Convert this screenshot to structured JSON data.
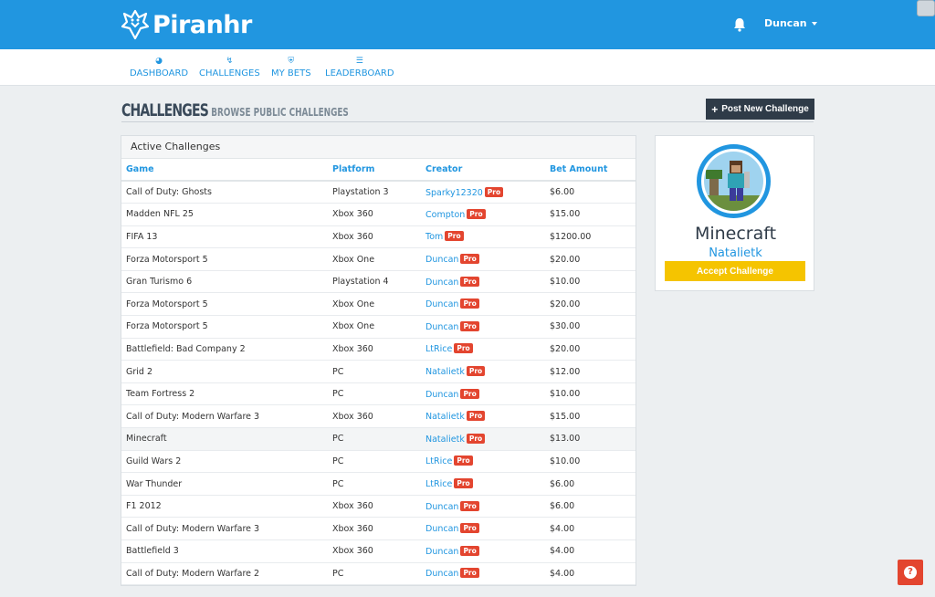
{
  "brand": {
    "name": "Piranhr",
    "logo_icon": "piranha-logo-icon"
  },
  "header": {
    "user_name": "Duncan",
    "bell_icon": "bell-icon"
  },
  "nav": [
    {
      "label": "DASHBOARD",
      "icon": "dashboard-icon"
    },
    {
      "label": "CHALLENGES",
      "icon": "bolt-icon"
    },
    {
      "label": "MY BETS",
      "icon": "shield-icon"
    },
    {
      "label": "LEADERBOARD",
      "icon": "list-icon"
    }
  ],
  "page": {
    "title": "CHALLENGES",
    "subtitle": "BROWSE PUBLIC CHALLENGES",
    "post_button": "Post New Challenge"
  },
  "panel": {
    "heading": "Active Challenges",
    "columns": [
      "Game",
      "Platform",
      "Creator",
      "Bet Amount"
    ],
    "badge": "Pro",
    "rows": [
      {
        "game": "Call of Duty: Ghosts",
        "platform": "Playstation 3",
        "creator": "Sparky12320",
        "bet": "$6.00"
      },
      {
        "game": "Madden NFL 25",
        "platform": "Xbox 360",
        "creator": "Compton",
        "bet": "$15.00"
      },
      {
        "game": "FIFA 13",
        "platform": "Xbox 360",
        "creator": "Tom",
        "bet": "$1200.00"
      },
      {
        "game": "Forza Motorsport 5",
        "platform": "Xbox One",
        "creator": "Duncan",
        "bet": "$20.00"
      },
      {
        "game": "Gran Turismo 6",
        "platform": "Playstation 4",
        "creator": "Duncan",
        "bet": "$10.00"
      },
      {
        "game": "Forza Motorsport 5",
        "platform": "Xbox One",
        "creator": "Duncan",
        "bet": "$20.00"
      },
      {
        "game": "Forza Motorsport 5",
        "platform": "Xbox One",
        "creator": "Duncan",
        "bet": "$30.00"
      },
      {
        "game": "Battlefield: Bad Company 2",
        "platform": "Xbox 360",
        "creator": "LtRice",
        "bet": "$20.00"
      },
      {
        "game": "Grid 2",
        "platform": "PC",
        "creator": "Natalietk",
        "bet": "$12.00"
      },
      {
        "game": "Team Fortress 2",
        "platform": "PC",
        "creator": "Duncan",
        "bet": "$10.00"
      },
      {
        "game": "Call of Duty: Modern Warfare 3",
        "platform": "Xbox 360",
        "creator": "Natalietk",
        "bet": "$15.00"
      },
      {
        "game": "Minecraft",
        "platform": "PC",
        "creator": "Natalietk",
        "bet": "$13.00"
      },
      {
        "game": "Guild Wars 2",
        "platform": "PC",
        "creator": "LtRice",
        "bet": "$10.00"
      },
      {
        "game": "War Thunder",
        "platform": "PC",
        "creator": "LtRice",
        "bet": "$6.00"
      },
      {
        "game": "F1 2012",
        "platform": "Xbox 360",
        "creator": "Duncan",
        "bet": "$6.00"
      },
      {
        "game": "Call of Duty: Modern Warfare 3",
        "platform": "Xbox 360",
        "creator": "Duncan",
        "bet": "$4.00"
      },
      {
        "game": "Battlefield 3",
        "platform": "Xbox 360",
        "creator": "Duncan",
        "bet": "$4.00"
      },
      {
        "game": "Call of Duty: Modern Warfare 2",
        "platform": "PC",
        "creator": "Duncan",
        "bet": "$4.00"
      }
    ]
  },
  "selected": {
    "game": "Minecraft",
    "creator": "Natalietk",
    "accept_button": "Accept Challenge",
    "avatar_icon": "minecraft-avatar"
  },
  "help": {
    "label": "?",
    "icon": "help-icon"
  },
  "colors": {
    "primary": "#2196e0",
    "dark": "#2f3b48",
    "pro_badge": "#e3452f",
    "accept": "#f5c400"
  }
}
